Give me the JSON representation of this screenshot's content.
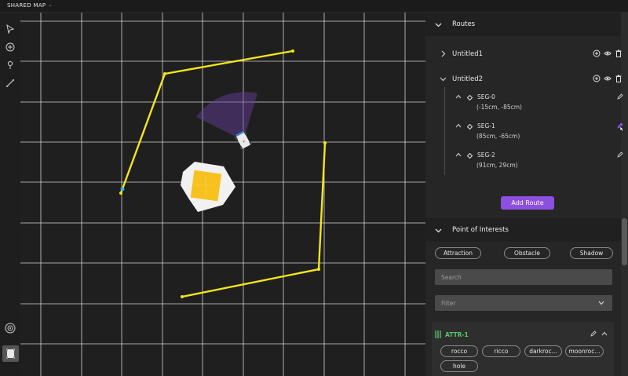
{
  "app": {
    "title": "SHARED MAP"
  },
  "toolbar": {
    "tools": [
      "pointer-icon",
      "add-circle-icon",
      "pin-icon",
      "ruler-icon"
    ],
    "bottom": [
      "target-icon",
      "robot-icon"
    ]
  },
  "routes_section": {
    "title": "Routes",
    "routes": [
      {
        "name": "Untitled1",
        "expanded": false
      },
      {
        "name": "Untitled2",
        "expanded": true,
        "segments": [
          {
            "name": "SEG-0",
            "coord": "(-15cm, -85cm)"
          },
          {
            "name": "SEG-1",
            "coord": "(85cm, -65cm)"
          },
          {
            "name": "SEG-2",
            "coord": "(91cm, 29cm)"
          }
        ]
      }
    ],
    "add_label": "Add Route"
  },
  "poi_section": {
    "title": "Point of Interests",
    "filters": [
      "Attraction",
      "Obstacle",
      "Shadow"
    ],
    "search_placeholder": "Search",
    "filter_placeholder": "Filter",
    "attr": {
      "title": "ATTR-1",
      "tags": [
        "rocco",
        "ricco",
        "darkroc...",
        "moonroc...",
        "hole"
      ]
    }
  },
  "colors": {
    "accent": "#8d4fe0",
    "route": "#f5e61a",
    "attr": "#57c96b",
    "grid": "#e8e8e8"
  }
}
